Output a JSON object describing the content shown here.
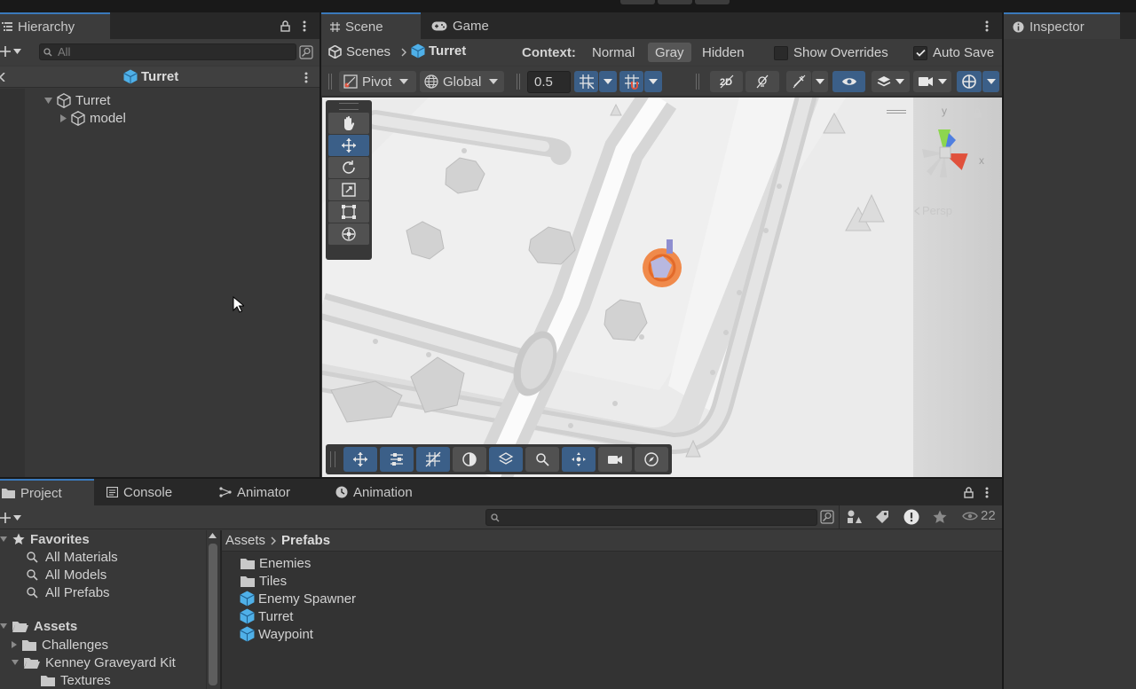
{
  "hierarchy": {
    "tab_label": "Hierarchy",
    "search_placeholder": "All",
    "header_title": "Turret",
    "tree": [
      {
        "label": "Turret"
      },
      {
        "label": "model"
      }
    ]
  },
  "scene": {
    "tabs": [
      {
        "label": "Scene"
      },
      {
        "label": "Game"
      }
    ],
    "breadcrumb": {
      "root": "Scenes",
      "current": "Turret"
    },
    "context": {
      "label": "Context:",
      "options": [
        {
          "label": "Normal"
        },
        {
          "label": "Gray"
        },
        {
          "label": "Hidden"
        }
      ],
      "selected": "Gray"
    },
    "show_overrides": {
      "label": "Show Overrides",
      "checked": false
    },
    "auto_save": {
      "label": "Auto Save",
      "checked": true
    },
    "toolbar": {
      "pivot": "Pivot",
      "global": "Global",
      "snap_value": "0.5"
    },
    "gizmo": {
      "y": "y",
      "x": "x",
      "persp": "Persp"
    }
  },
  "inspector": {
    "tab_label": "Inspector"
  },
  "bottom": {
    "tabs": [
      {
        "label": "Project"
      },
      {
        "label": "Console"
      },
      {
        "label": "Animator"
      },
      {
        "label": "Animation"
      }
    ],
    "hidden_count": "22",
    "favorites": {
      "label": "Favorites",
      "items": [
        {
          "label": "All Materials"
        },
        {
          "label": "All Models"
        },
        {
          "label": "All Prefabs"
        }
      ]
    },
    "assets": {
      "label": "Assets",
      "items": [
        {
          "label": "Challenges"
        },
        {
          "label": "Kenney Graveyard Kit"
        },
        {
          "label": "Textures"
        }
      ]
    },
    "breadcrumb": {
      "root": "Assets",
      "current": "Prefabs"
    },
    "files": [
      {
        "label": "Enemies",
        "kind": "folder"
      },
      {
        "label": "Tiles",
        "kind": "folder"
      },
      {
        "label": "Enemy Spawner",
        "kind": "prefab"
      },
      {
        "label": "Turret",
        "kind": "prefab"
      },
      {
        "label": "Waypoint",
        "kind": "prefab"
      }
    ]
  },
  "colors": {
    "accent": "#3a79bb",
    "prefab": "#4fb0e8",
    "active_tool": "#3b5f88"
  }
}
